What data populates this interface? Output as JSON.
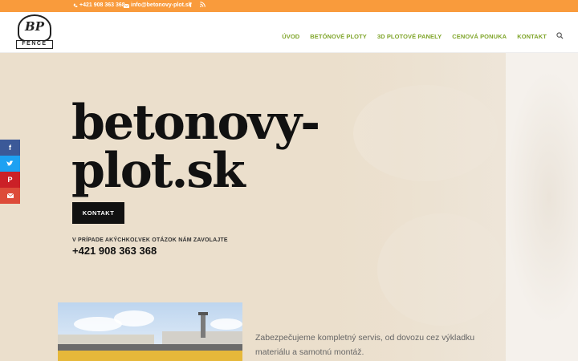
{
  "topbar": {
    "phone": "+421 908 363 368",
    "email": "info@betonovy-plot.sk",
    "icons": [
      "phone-icon",
      "email-icon",
      "facebook-icon",
      "rss-icon"
    ],
    "color": "#f99b3c"
  },
  "logo": {
    "monogram": "BP",
    "word": "FENCE"
  },
  "nav": {
    "items": [
      "ÚVOD",
      "BETÓNOVÉ PLOTY",
      "3D PLOTOVÉ PANELY",
      "CENOVÁ PONUKA",
      "KONTAKT"
    ],
    "color": "#7fa52a"
  },
  "hero": {
    "title_line1": "betonovy-",
    "title_line2": "plot.sk",
    "button_label": "KONTAKT",
    "call_note": "V PRÍPADE AKÝCHKOĽVEK OTÁZOK NÁM ZAVOLAJTE",
    "call_phone": "+421 908 363 368",
    "background": "#ebdfcc"
  },
  "service": {
    "text": "Zabezpečujeme kompletný servis, od dovozu cez výkladku materiálu a samotnú montáž."
  },
  "social": {
    "items": [
      "facebook-icon",
      "twitter-icon",
      "pinterest-icon",
      "email-icon"
    ],
    "colors": [
      "#3b5998",
      "#1da1f2",
      "#cb2027",
      "#dd4b39"
    ]
  }
}
